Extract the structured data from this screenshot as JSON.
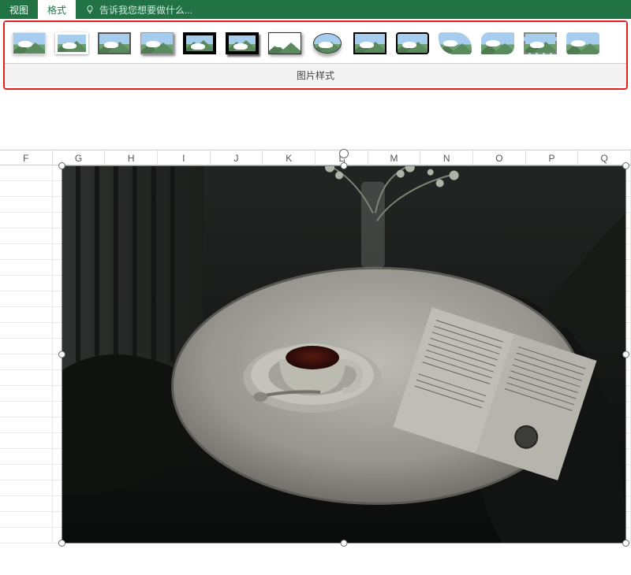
{
  "ribbon": {
    "tab_view": "视图",
    "tab_format": "格式",
    "tellme_placeholder": "告诉我您想要做什么...",
    "gallery_label": "图片样式",
    "style_names": [
      "simple-frame",
      "white-mat",
      "metal-frame",
      "drop-shadow",
      "black-frame",
      "black-bevel",
      "double-frame",
      "oval-soft",
      "compound-black",
      "rounded-black",
      "snip-corner",
      "round-corner",
      "dashed-border",
      "soft-round"
    ]
  },
  "sheet": {
    "columns": [
      "F",
      "G",
      "H",
      "I",
      "J",
      "K",
      "L",
      "M",
      "N",
      "O",
      "P",
      "Q"
    ],
    "row_count": 24
  }
}
